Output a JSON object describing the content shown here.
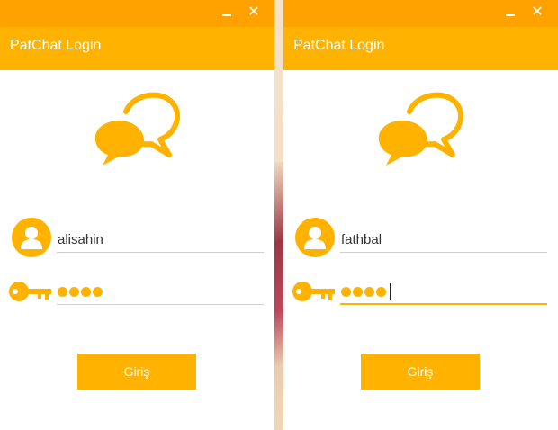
{
  "theme": {
    "titlebar_color": "#ffa200",
    "header_color": "#ffb300",
    "accent": "#ffb300"
  },
  "windows": [
    {
      "title": "PatChat Login",
      "controls": {
        "minimize_icon": "minimize-icon",
        "close_icon": "close-icon",
        "close_glyph": "✕"
      },
      "username": "alisahin",
      "password_mask_count": 4,
      "button_label": "Giriş",
      "password_focused": false
    },
    {
      "title": "PatChat Login",
      "controls": {
        "minimize_icon": "minimize-icon",
        "close_icon": "close-icon",
        "close_glyph": "✕"
      },
      "username": "fathbal",
      "password_mask_count": 4,
      "button_label": "Giriş",
      "password_focused": true
    }
  ]
}
